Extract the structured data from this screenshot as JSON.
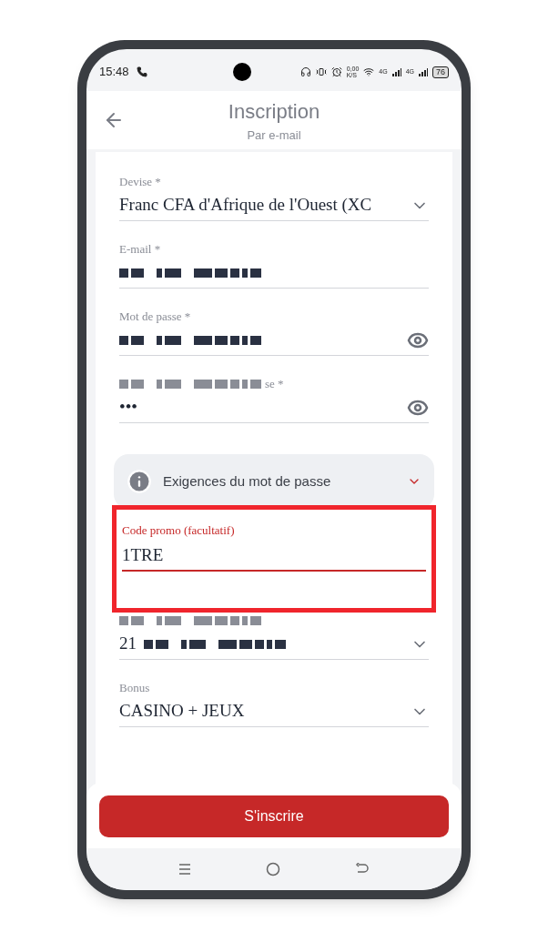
{
  "status_bar": {
    "time": "15:48",
    "network_speed": "0,00",
    "speed_unit": "K/S",
    "signal_1": "4G",
    "signal_2": "4G",
    "battery": "76"
  },
  "header": {
    "title": "Inscription",
    "subtitle": "Par e-mail"
  },
  "fields_top": [
    {
      "kind": "select",
      "label": "Devise *",
      "value": "Franc CFA d'Afrique de l'Ouest (XC",
      "label_redacted": false,
      "value_redacted": false
    },
    {
      "kind": "text",
      "label": "E-mail *",
      "label_redacted": false,
      "value_redacted": true
    },
    {
      "kind": "password",
      "label": "Mot de passe *",
      "label_redacted": false,
      "value_redacted": true
    },
    {
      "kind": "password",
      "label": "se *",
      "value": "•••",
      "label_redacted": true,
      "value_redacted": false
    }
  ],
  "info_panel": {
    "label": "Exigences du mot de passe",
    "expanded": false
  },
  "promo_field": {
    "label": "Code promo (facultatif)",
    "value": "1TRE",
    "focused": true,
    "highlighted": true
  },
  "fields_bottom": [
    {
      "kind": "select",
      "value": "21",
      "label_redacted": true,
      "value_redacted": true
    },
    {
      "kind": "select",
      "label": "Bonus",
      "value": "CASINO + JEUX",
      "label_redacted": false,
      "value_redacted": false
    }
  ],
  "submit_button": {
    "label": "S'inscrire"
  }
}
